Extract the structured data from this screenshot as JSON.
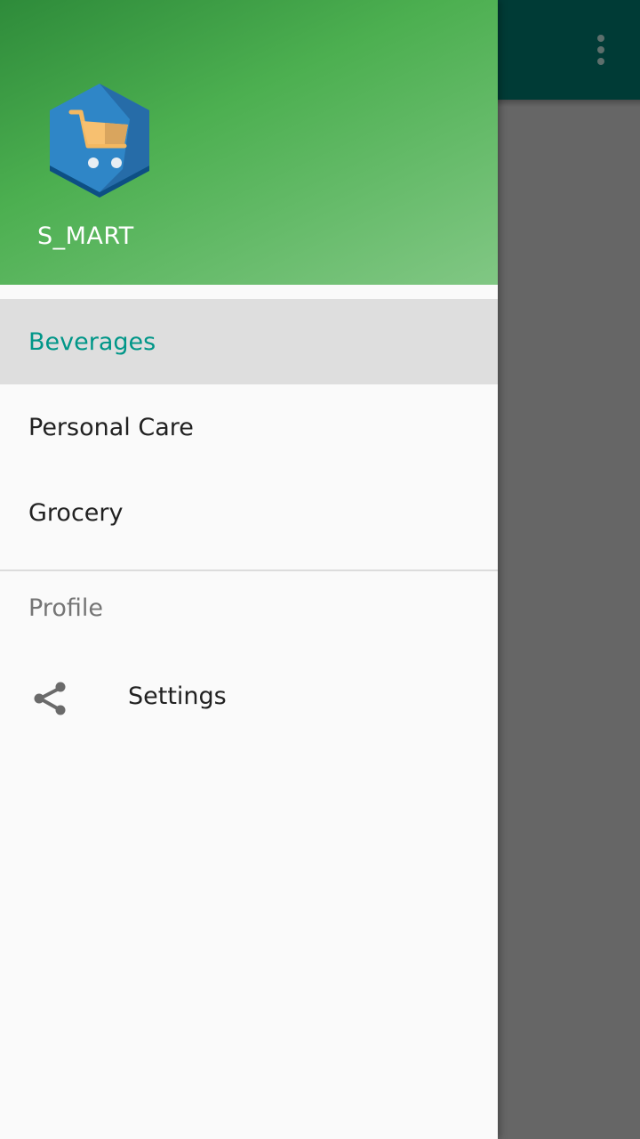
{
  "drawer": {
    "app_name": "S_MART",
    "logo_icon": "shopping-cart-hexagon-icon",
    "items": [
      {
        "label": "Beverages",
        "active": true
      },
      {
        "label": "Personal Care",
        "active": false
      },
      {
        "label": "Grocery",
        "active": false
      }
    ],
    "section_header": "Profile",
    "settings": {
      "label": "Settings",
      "icon": "share-icon"
    }
  },
  "toolbar": {
    "overflow_icon": "more-vertical-icon"
  },
  "colors": {
    "accent": "#009688",
    "toolbar": "#003b36",
    "header_green": "#4caf50"
  }
}
